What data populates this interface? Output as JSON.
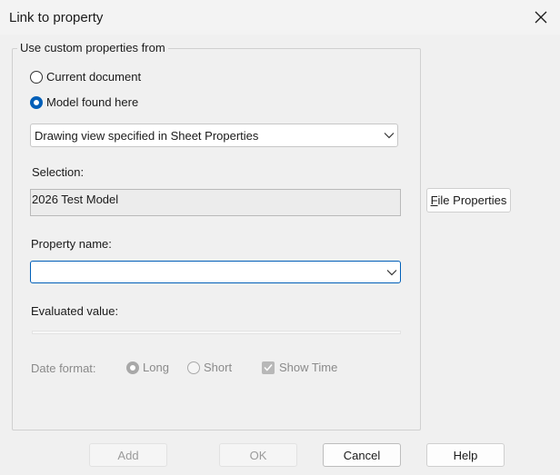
{
  "window": {
    "title": "Link to property"
  },
  "group": {
    "label": "Use custom properties from",
    "radio_current": "Current document",
    "radio_model": "Model found here",
    "source_combo": "Drawing view specified in Sheet Properties"
  },
  "selection": {
    "label": "Selection:",
    "value": "2026 Test Model"
  },
  "property_name": {
    "label": "Property name:",
    "value": ""
  },
  "evaluated": {
    "label": "Evaluated value:",
    "value": ""
  },
  "date_format": {
    "label": "Date format:",
    "long": "Long",
    "short": "Short",
    "show_time": "Show Time"
  },
  "buttons": {
    "file_properties_first": "F",
    "file_properties_rest": "ile Properties",
    "add": "Add",
    "ok": "OK",
    "cancel": "Cancel",
    "help": "Help"
  },
  "colors": {
    "accent": "#005fb8"
  }
}
